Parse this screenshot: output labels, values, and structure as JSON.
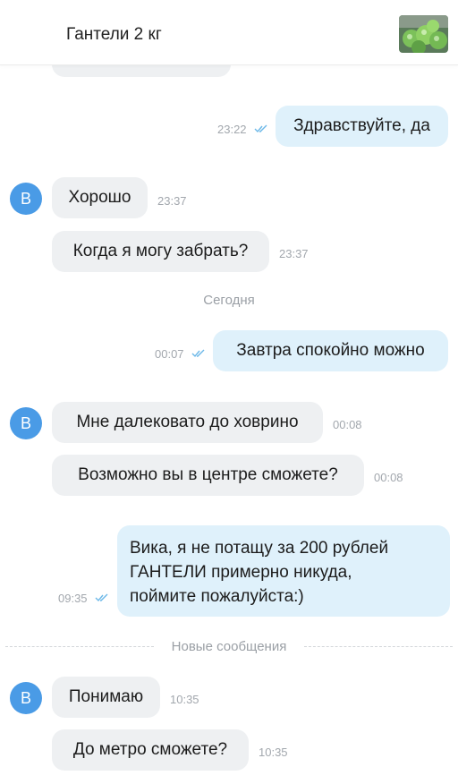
{
  "header": {
    "title": "Гантели 2 кг",
    "thumbnail_icon": "dumbbells-photo"
  },
  "avatar_letter": "В",
  "day_separator": "Сегодня",
  "new_messages_separator": "Новые сообщения",
  "messages": [
    {
      "direction": "out",
      "text": "Здравствуйте, да",
      "time": "23:22",
      "status": "read"
    },
    {
      "direction": "in",
      "text": "Хорошо",
      "time": "23:37"
    },
    {
      "direction": "in",
      "text": "Когда я могу забрать?",
      "time": "23:37"
    },
    {
      "direction": "out",
      "text": "Завтра спокойно можно",
      "time": "00:07",
      "status": "read"
    },
    {
      "direction": "in",
      "text": "Мне далековато до ховрино",
      "time": "00:08"
    },
    {
      "direction": "in",
      "text": "Возможно вы в центре сможете?",
      "time": "00:08"
    },
    {
      "direction": "out",
      "text": "Вика, я не потащу за 200 рублей\nГАНТЕЛИ примерно никуда,\nпоймите пожалуйста:)",
      "time": "09:35",
      "status": "read"
    },
    {
      "direction": "in",
      "text": "Понимаю",
      "time": "10:35"
    },
    {
      "direction": "in",
      "text": "До метро сможете?",
      "time": "10:35"
    }
  ],
  "colors": {
    "incoming_bubble": "#eef0f2",
    "outgoing_bubble": "#dff1fb",
    "avatar": "#4a9be6",
    "read_check": "#6cb8e8"
  }
}
